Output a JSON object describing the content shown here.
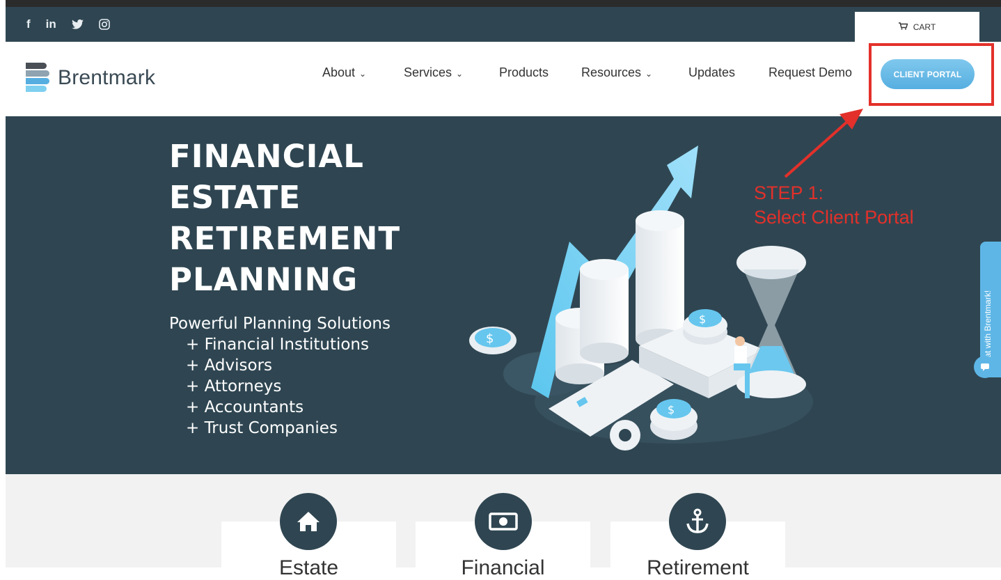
{
  "social": {
    "facebook": "f",
    "linkedin": "in",
    "twitter_icon": "twitter-icon",
    "instagram_icon": "instagram-icon"
  },
  "cart": {
    "label": "CART",
    "icon": "cart-icon"
  },
  "brand": {
    "name": "Brentmark",
    "colors": [
      "#4a4f56",
      "#8fa3b0",
      "#56aee0",
      "#7fd0f0"
    ]
  },
  "nav": {
    "about": "About",
    "services": "Services",
    "products": "Products",
    "resources": "Resources",
    "updates": "Updates",
    "request_demo": "Request Demo",
    "client_portal": "CLIENT PORTAL"
  },
  "hero": {
    "title_lines": [
      "FINANCIAL",
      "ESTATE",
      "RETIREMENT",
      "PLANNING"
    ],
    "subtitle": "Powerful Planning Solutions",
    "items": [
      "+ Financial Institutions",
      "+ Advisors",
      "+ Attorneys",
      "+ Accountants",
      "+ Trust Companies"
    ]
  },
  "annotation": {
    "line1": "STEP 1:",
    "line2": "Select Client Portal",
    "color": "#e3302a"
  },
  "chat": {
    "label": "Chat with Brentmark!"
  },
  "cards": [
    {
      "title": "Estate",
      "icon": "home-icon"
    },
    {
      "title": "Financial",
      "icon": "money-icon"
    },
    {
      "title": "Retirement",
      "icon": "anchor-icon"
    }
  ],
  "colors": {
    "header_dark": "#2f4652",
    "accent": "#56aee0"
  }
}
